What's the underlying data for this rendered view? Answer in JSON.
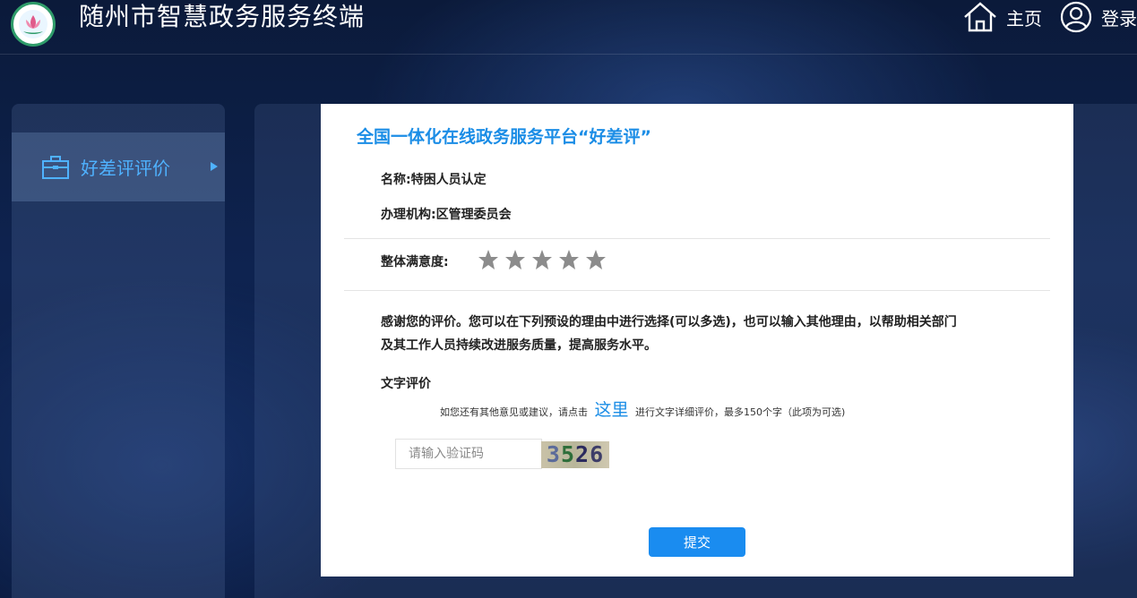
{
  "header": {
    "title": "随州市智慧政务服务终端",
    "nav": [
      {
        "label": "主页",
        "icon": "home-icon"
      },
      {
        "label": "登录",
        "icon": "user-icon"
      }
    ]
  },
  "sidebar": {
    "items": [
      {
        "label": "好差评评价",
        "icon": "briefcase-icon",
        "active": true
      }
    ]
  },
  "card": {
    "title": "全国一体化在线政务服务平台“好差评”",
    "name": "名称:特困人员认定",
    "agency": "办理机构:区管理委员会",
    "rating_label": "整体满意度:",
    "rating": {
      "value": 0,
      "max": 5
    },
    "thanks_line1": "感谢您的评价。您可以在下列预设的理由中进行选择(可以多选)，也可以输入其他理由，以帮助相关部门",
    "thanks_line2": "及其工作人员持续改进服务质量，提高服务水平。",
    "text_review_title": "文字评价",
    "hint_prefix": "如您还有其他意见或建议，请点击",
    "hint_link": "这里",
    "hint_suffix": "进行文字详细评价，最多150个字（此项为可选)",
    "captcha_placeholder": "请输入验证码",
    "captcha_digits": [
      "3",
      "5",
      "2",
      "6"
    ],
    "submit_label": "提交"
  },
  "colors": {
    "accent": "#1b8de6",
    "sidebar_label": "#4fb2ff",
    "button": "#1a8cf0",
    "star": "#8c8c8c"
  }
}
